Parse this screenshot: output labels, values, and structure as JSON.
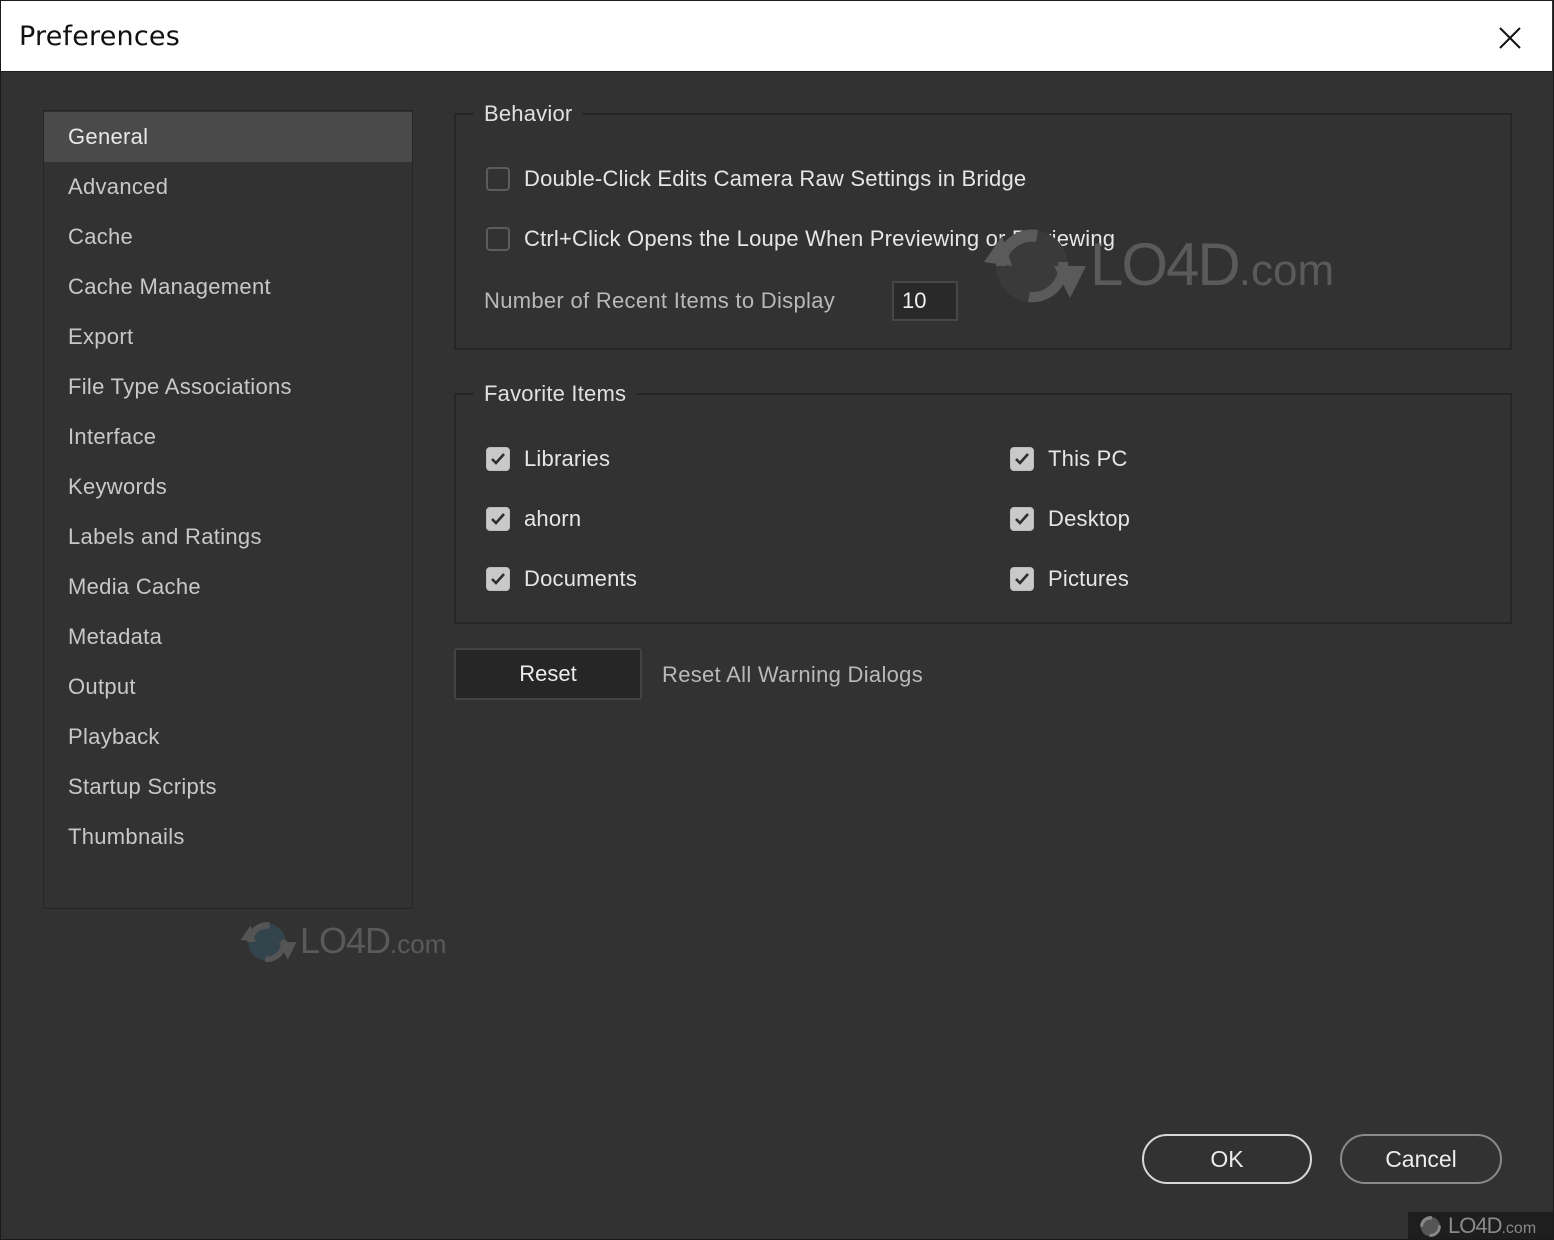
{
  "window": {
    "title": "Preferences",
    "close_icon": "close-icon"
  },
  "sidebar": {
    "selected": "General",
    "items": [
      {
        "label": "General"
      },
      {
        "label": "Advanced"
      },
      {
        "label": "Cache"
      },
      {
        "label": "Cache Management"
      },
      {
        "label": "Export"
      },
      {
        "label": "File Type Associations"
      },
      {
        "label": "Interface"
      },
      {
        "label": "Keywords"
      },
      {
        "label": "Labels and Ratings"
      },
      {
        "label": "Media Cache"
      },
      {
        "label": "Metadata"
      },
      {
        "label": "Output"
      },
      {
        "label": "Playback"
      },
      {
        "label": "Startup Scripts"
      },
      {
        "label": "Thumbnails"
      }
    ]
  },
  "behavior": {
    "title": "Behavior",
    "options": [
      {
        "label": "Double-Click Edits Camera Raw Settings in Bridge",
        "checked": false
      },
      {
        "label": "Ctrl+Click Opens the Loupe When Previewing or Reviewing",
        "checked": false
      }
    ],
    "recent_items_label": "Number of Recent Items to Display",
    "recent_items_value": "10"
  },
  "favorites": {
    "title": "Favorite Items",
    "items": [
      {
        "label": "Libraries",
        "checked": true
      },
      {
        "label": "ahorn",
        "checked": true
      },
      {
        "label": "Documents",
        "checked": true
      },
      {
        "label": "This PC",
        "checked": true
      },
      {
        "label": "Desktop",
        "checked": true
      },
      {
        "label": "Pictures",
        "checked": true
      }
    ]
  },
  "reset": {
    "button_label": "Reset",
    "description": "Reset All Warning Dialogs"
  },
  "footer": {
    "ok_label": "OK",
    "cancel_label": "Cancel"
  },
  "watermark": {
    "brand": "LO4D",
    "suffix": ".com"
  }
}
